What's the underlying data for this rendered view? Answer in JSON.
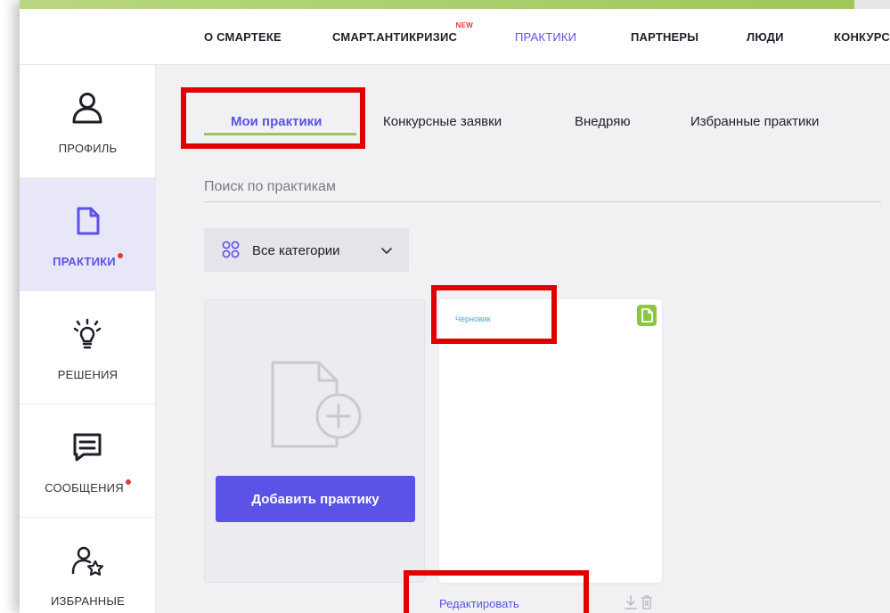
{
  "header": {
    "nav": [
      {
        "label": "О СМАРТЕКЕ",
        "active": false
      },
      {
        "label": "СМАРТ.АНТИКРИЗИС",
        "active": false,
        "badge": "NEW"
      },
      {
        "label": "ПРАКТИКИ",
        "active": true
      },
      {
        "label": "ПАРТНЕРЫ",
        "active": false
      },
      {
        "label": "ЛЮДИ",
        "active": false
      },
      {
        "label": "КОНКУРС",
        "active": false
      }
    ]
  },
  "sidebar": {
    "items": [
      {
        "label": "ПРОФИЛЬ",
        "icon": "user-icon",
        "active": false,
        "dot": false
      },
      {
        "label": "ПРАКТИКИ",
        "icon": "document-icon",
        "active": true,
        "dot": true
      },
      {
        "label": "РЕШЕНИЯ",
        "icon": "lightbulb-icon",
        "active": false,
        "dot": false
      },
      {
        "label": "СООБЩЕНИЯ",
        "icon": "message-icon",
        "active": false,
        "dot": true
      },
      {
        "label": "ИЗБРАННЫЕ",
        "icon": "favorites-icon",
        "active": false,
        "dot": false
      }
    ]
  },
  "tabs": [
    {
      "label": "Мои практики",
      "active": true
    },
    {
      "label": "Конкурсные заявки",
      "active": false
    },
    {
      "label": "Внедряю",
      "active": false
    },
    {
      "label": "Избранные практики",
      "active": false
    }
  ],
  "search": {
    "placeholder": "Поиск по практикам",
    "value": ""
  },
  "category_filter": {
    "label": "Все категории",
    "icon": "categories-grid-icon"
  },
  "add_card": {
    "button_label": "Добавить практику",
    "icon": "add-document-icon"
  },
  "draft_card": {
    "status": "Черновик",
    "badge_icon": "document-icon",
    "edit_label": "Редактировать",
    "actions": [
      "download-icon",
      "trash-icon"
    ]
  },
  "colors": {
    "accent": "#5b52e8",
    "green": "#9cc65a",
    "highlight": "#e00000",
    "status_blue": "#4aa8d8",
    "notification_dot": "#e23b3b"
  }
}
